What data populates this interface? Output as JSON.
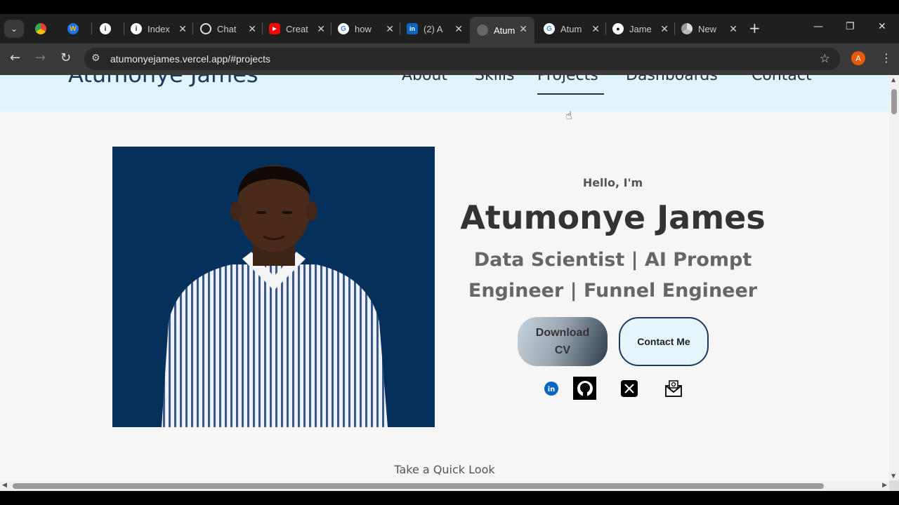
{
  "browser": {
    "tabs": [
      {
        "label": "",
        "favicon": "drive-icon"
      },
      {
        "label": "",
        "favicon": "w-icon"
      },
      {
        "label": "",
        "favicon": "info-icon"
      },
      {
        "label": "Index",
        "favicon": "info-icon"
      },
      {
        "label": "Chat",
        "favicon": "chatgpt-icon"
      },
      {
        "label": "Creat",
        "favicon": "youtube-icon"
      },
      {
        "label": "how",
        "favicon": "google-icon"
      },
      {
        "label": "(2) A",
        "favicon": "linkedin-icon"
      },
      {
        "label": "Atum",
        "favicon": "globe-icon"
      },
      {
        "label": "Atum",
        "favicon": "google-icon"
      },
      {
        "label": "Jame",
        "favicon": "github-icon"
      },
      {
        "label": "New",
        "favicon": "chrome-icon"
      }
    ],
    "url": "atumonyejames.vercel.app/#projects",
    "profile_initial": "A"
  },
  "site": {
    "logo": "Atumonye James",
    "nav": [
      "About",
      "Skills",
      "Projects",
      "Dashboards",
      "Contact"
    ],
    "active_nav": "Projects",
    "hero": {
      "greeting": "Hello, I'm",
      "name": "Atumonye James",
      "role_line1": "Data Scientist | AI Prompt",
      "role_line2": "Engineer | Funnel Engineer",
      "download_line1": "Download",
      "download_line2": "CV",
      "contact_label": "Contact Me"
    },
    "socials": [
      "linkedin-icon",
      "github-icon",
      "x-icon",
      "mail-icon"
    ],
    "quick_look": "Take a Quick Look"
  },
  "colors": {
    "header_bg": "#e1f3fb",
    "accent": "#1e3a5f",
    "photo_bg": "#05305b"
  }
}
